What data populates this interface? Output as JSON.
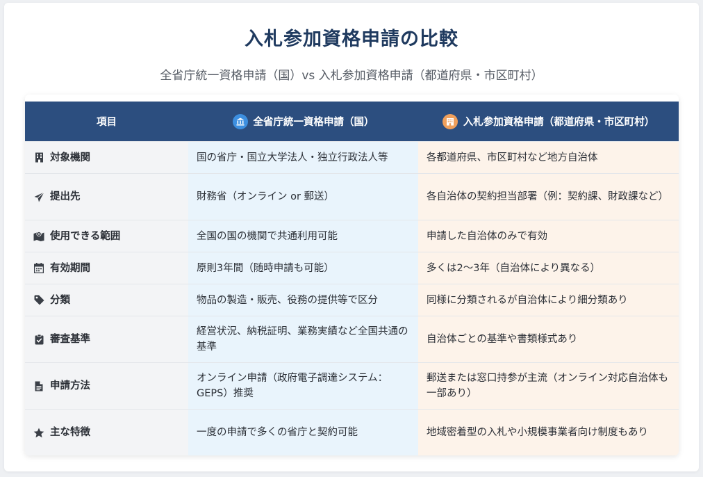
{
  "title": "入札参加資格申請の比較",
  "subtitle": "全省庁統一資格申請（国）vs 入札参加資格申請（都道府県・市区町村）",
  "colors": {
    "header_bg": "#2c4e7f",
    "gov_bg": "#e9f4fc",
    "local_bg": "#fdf3ea",
    "label_bg": "#f3f4f6"
  },
  "header": {
    "item": "項目",
    "gov": "全省庁統一資格申請（国）",
    "gov_icon": "government-building-icon",
    "local": "入札参加資格申請（都道府県・市区町村）",
    "local_icon": "city-building-icon"
  },
  "rows": [
    {
      "label": "対象機関",
      "icon": "building-icon",
      "gov": "国の省庁・国立大学法人・独立行政法人等",
      "local": "各都道府県、市区町村など地方自治体"
    },
    {
      "label": "提出先",
      "icon": "paper-plane-icon",
      "gov": "財務省（オンライン or 郵送）",
      "local": "各自治体の契約担当部署（例：契約課、財政課など）"
    },
    {
      "label": "使用できる範囲",
      "icon": "map-marker-icon",
      "gov": "全国の国の機関で共通利用可能",
      "local": "申請した自治体のみで有効"
    },
    {
      "label": "有効期間",
      "icon": "calendar-icon",
      "gov": "原則3年間（随時申請も可能）",
      "local": "多くは2〜3年（自治体により異なる）"
    },
    {
      "label": "分類",
      "icon": "tag-icon",
      "gov": "物品の製造・販売、役務の提供等で区分",
      "local": "同様に分類されるが自治体により細分類あり"
    },
    {
      "label": "審査基準",
      "icon": "clipboard-check-icon",
      "gov": "経営状況、納税証明、業務実績など全国共通の基準",
      "local": "自治体ごとの基準や書類様式あり"
    },
    {
      "label": "申請方法",
      "icon": "document-icon",
      "gov": "オンライン申請（政府電子調達システム：GEPS）推奨",
      "local": "郵送または窓口持参が主流（オンライン対応自治体も一部あり）"
    },
    {
      "label": "主な特徴",
      "icon": "star-icon",
      "gov": "一度の申請で多くの省庁と契約可能",
      "local": "地域密着型の入札や小規模事業者向け制度もあり"
    }
  ]
}
